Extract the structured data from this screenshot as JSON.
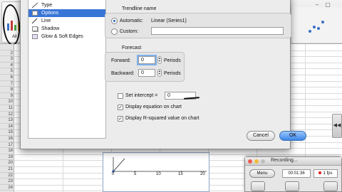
{
  "sidebar": {
    "items": [
      {
        "label": "Type"
      },
      {
        "label": "Options"
      },
      {
        "label": "Line"
      },
      {
        "label": "Shadow"
      },
      {
        "label": "Glow & Soft Edges"
      }
    ]
  },
  "ribbon": {
    "all_label": "All"
  },
  "row_numbers": [
    "",
    "2",
    "3",
    "4",
    "5",
    "6",
    "7",
    "8",
    "9",
    "10",
    "11",
    "12",
    "13",
    "14",
    "15",
    "16",
    "17",
    "18",
    "19",
    "20",
    "21",
    "22",
    "23",
    "24"
  ],
  "dialog": {
    "trendline_name": {
      "title": "Trendline name",
      "automatic_label": "Automatic:",
      "automatic_value": "Linear (Series1)",
      "custom_label": "Custom:",
      "custom_value": ""
    },
    "forecast": {
      "title": "Forecast",
      "forward_label": "Forward:",
      "forward_value": "0",
      "forward_unit": "Periods",
      "backward_label": "Backward:",
      "backward_value": "0",
      "backward_unit": "Periods"
    },
    "set_intercept_label": "Set intercept =",
    "set_intercept_value": "0",
    "display_equation_label": "Display equation on chart",
    "display_r_squared_label": "Display R-squared value on chart",
    "cancel_label": "Cancel",
    "ok_label": "OK"
  },
  "chart_axis": {
    "ticks": [
      "0",
      "5",
      "10",
      "15",
      "20"
    ]
  },
  "recording": {
    "title": "Recording...",
    "menu_label": "Menu",
    "time": "00:01:36",
    "fps": "1 fps"
  }
}
